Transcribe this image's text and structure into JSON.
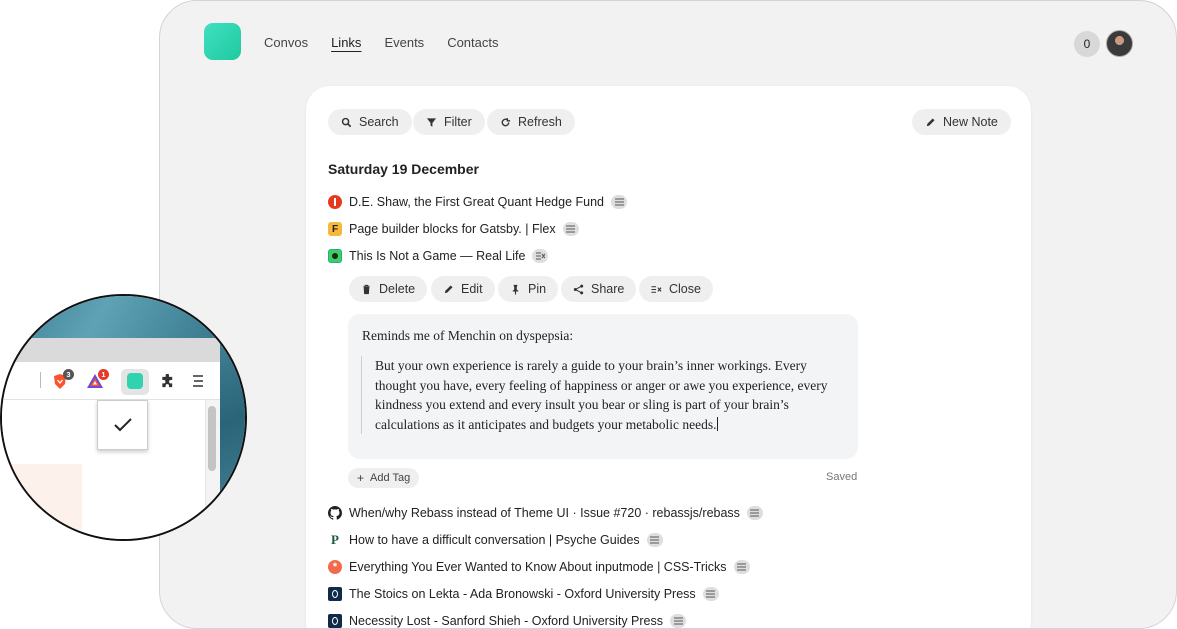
{
  "nav": {
    "items": [
      {
        "label": "Convos",
        "active": false
      },
      {
        "label": "Links",
        "active": true
      },
      {
        "label": "Events",
        "active": false
      },
      {
        "label": "Contacts",
        "active": false
      }
    ],
    "count": "0"
  },
  "toolbar": {
    "search_label": "Search",
    "filter_label": "Filter",
    "refresh_label": "Refresh",
    "new_note_label": "New Note"
  },
  "date_heading": "Saturday 19 December",
  "links_top": [
    {
      "title": "D.E. Shaw, the First Great Quant Hedge Fund",
      "icon": "d-e-shaw-favicon"
    },
    {
      "title": "Page builder blocks for Gatsby. | Flex",
      "icon": "flex-favicon"
    },
    {
      "title": "This Is Not a Game — Real Life",
      "icon": "real-life-favicon"
    }
  ],
  "actions": {
    "delete": "Delete",
    "edit": "Edit",
    "pin": "Pin",
    "share": "Share",
    "close": "Close"
  },
  "note": {
    "intro": "Reminds me of Menchin on dyspepsia:",
    "quote": "But your own experience is rarely a guide to your brain’s inner workings. Every thought you have, every feeling of happiness or anger or awe you experience, every kindness you extend and every insult you bear or sling is part of your brain’s calculations as it anticipates and budgets your metabolic needs.",
    "add_tag": "Add Tag",
    "status": "Saved"
  },
  "links_bottom": [
    {
      "title": "When/why Rebass instead of Theme UI · Issue #720 · rebassjs/rebass",
      "icon": "github-favicon"
    },
    {
      "title": "How to have a difficult conversation | Psyche Guides",
      "icon": "psyche-favicon"
    },
    {
      "title": "Everything You Ever Wanted to Know About inputmode | CSS-Tricks",
      "icon": "css-tricks-favicon"
    },
    {
      "title": "The Stoics on Lekta - Ada Bronowski - Oxford University Press",
      "icon": "oxford-favicon"
    },
    {
      "title": "Necessity Lost - Sanford Shieh - Oxford University Press",
      "icon": "oxford-favicon"
    }
  ],
  "browser_zoom": {
    "brave_badge": "3",
    "rewards_badge": "1"
  },
  "colors": {
    "accent": "#2fd3b0",
    "pill_bg": "#efefef",
    "page_bg": "#f2f2f2"
  }
}
